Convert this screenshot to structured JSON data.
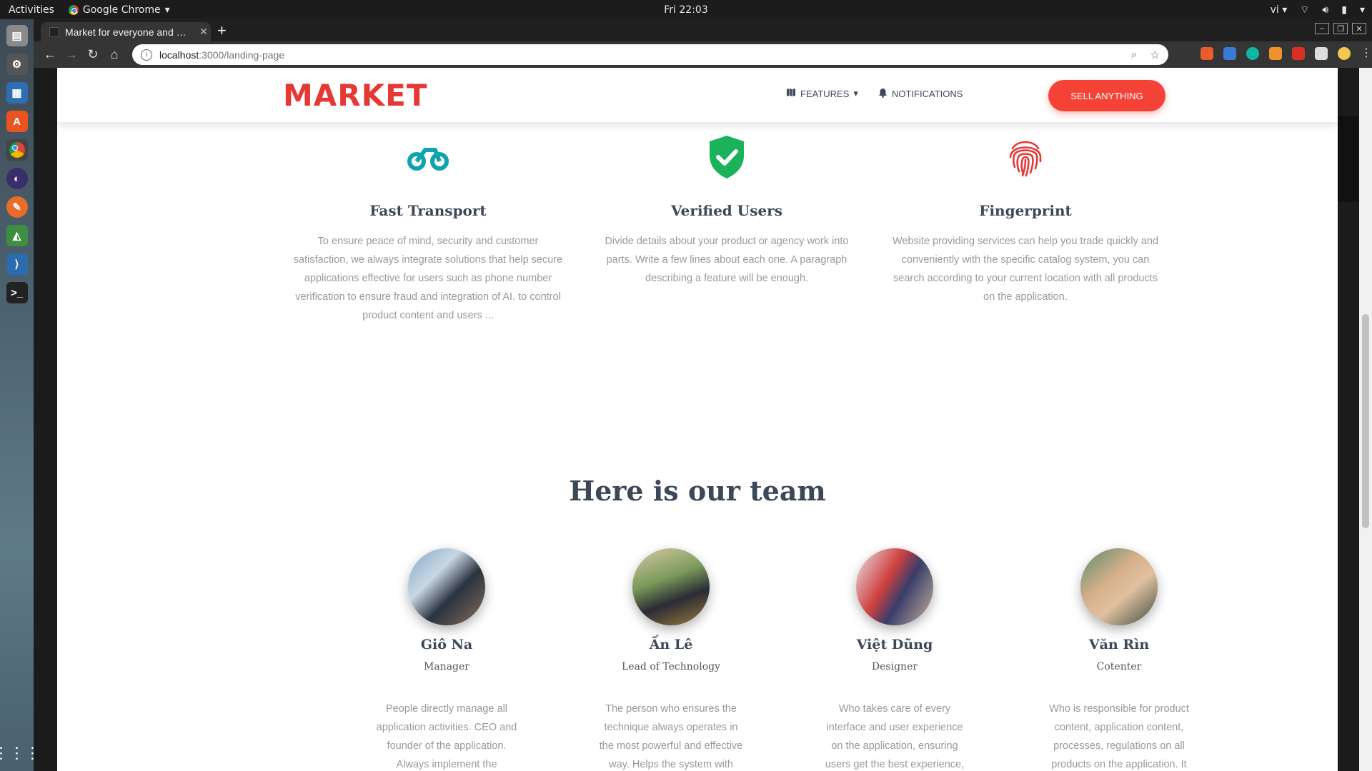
{
  "os": {
    "activities": "Activities",
    "app_name": "Google Chrome",
    "clock": "Fri 22:03",
    "lang": "vi"
  },
  "browser": {
    "tab_title": "Market for everyone and …",
    "url_host": "localhost",
    "url_path": ":3000/landing-page"
  },
  "site": {
    "brand": "MARKET",
    "nav": {
      "features": "FEATURES",
      "notifications": "NOTIFICATIONS",
      "sell": "SELL ANYTHING"
    },
    "colors": {
      "accent": "#f44336",
      "brand": "#e53935",
      "teal": "#0fa3b1",
      "green": "#1bb35a"
    },
    "features": [
      {
        "icon": "bike-icon",
        "title": "Fast Transport",
        "text": "To ensure peace of mind, security and customer satisfaction, we always integrate solutions that help secure applications effective for users such as phone number verification to ensure fraud and integration of AI. to control product content and users ..."
      },
      {
        "icon": "verified-shield-icon",
        "title": "Verified Users",
        "text": "Divide details about your product or agency work into parts. Write a few lines about each one. A paragraph describing a feature will be enough."
      },
      {
        "icon": "fingerprint-icon",
        "title": "Fingerprint",
        "text": "Website providing services can help you trade quickly and conveniently with the specific catalog system, you can search according to your current location with all products on the application."
      }
    ],
    "team_title": "Here is our team",
    "team": [
      {
        "name": "Giô Na",
        "role": "Manager",
        "text": "People directly manage all application activities. CEO and founder of the application. Always implement the"
      },
      {
        "name": "Ấn Lê",
        "role": "Lead of Technology",
        "text": "The person who ensures the technique always operates in the most powerful and effective way. Helps the system with"
      },
      {
        "name": "Việt Dũng",
        "role": "Designer",
        "text": "Who takes care of every interface and user experience on the application, ensuring users get the best experience,"
      },
      {
        "name": "Văn Rìn",
        "role": "Cotenter",
        "text": "Who is responsible for product content, application content, processes, regulations on all products on the application. It"
      }
    ]
  }
}
